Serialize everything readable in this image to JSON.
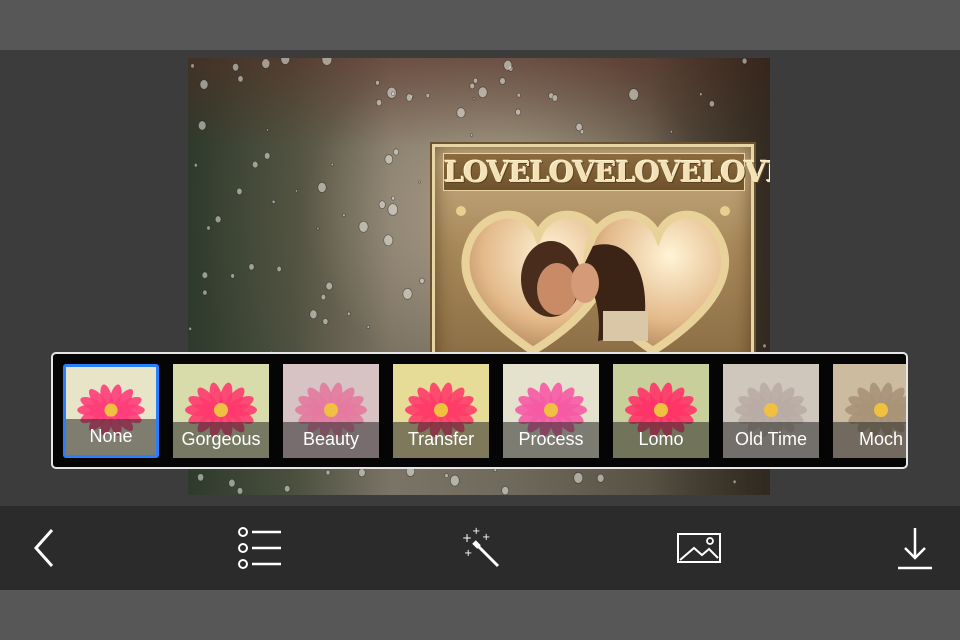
{
  "photo": {
    "plaque_text": "LOVELOVELOVELOVE"
  },
  "filters": [
    {
      "label": "None",
      "tint": "#e8e4c8",
      "petal": "#ff3d7a",
      "selected": true
    },
    {
      "label": "Gorgeous",
      "tint": "#d8dcaa",
      "petal": "#ff3a6e",
      "selected": false
    },
    {
      "label": "Beauty",
      "tint": "#d7c2c4",
      "petal": "#e47aa0",
      "selected": false
    },
    {
      "label": "Transfer",
      "tint": "#e6dc98",
      "petal": "#ff3c68",
      "selected": false
    },
    {
      "label": "Process",
      "tint": "#e4e2cc",
      "petal": "#f65aa4",
      "selected": false
    },
    {
      "label": "Lomo",
      "tint": "#c9cf9a",
      "petal": "#ff3468",
      "selected": false
    },
    {
      "label": "Old Time",
      "tint": "#cfc6bc",
      "petal": "#b8aca4",
      "selected": false
    },
    {
      "label": "Moch",
      "tint": "#cdbba0",
      "petal": "#a89478",
      "selected": false
    }
  ],
  "toolbar": {
    "back": "chevron-left-icon",
    "list": "list-icon",
    "effects": "magic-wand-icon",
    "gallery": "image-icon",
    "download": "download-icon"
  }
}
